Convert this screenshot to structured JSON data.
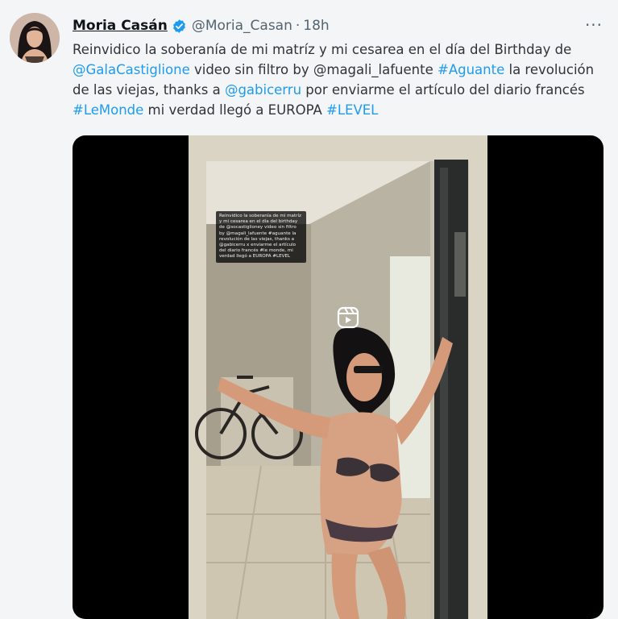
{
  "author": {
    "display_name": "Moria Casán",
    "handle": "@Moria_Casan",
    "separator": "·",
    "time": "18h"
  },
  "more_label": "···",
  "tweet": {
    "t1": "Reinvidico la soberanía de mi matríz y mi cesarea en el día del Birthday de ",
    "m1": "@GalaCastiglione",
    "t2": " video sin filtro by @magali_lafuente ",
    "h1": "#Aguante",
    "t3": " la revolución de las viejas, thanks a ",
    "m2": "@gabicerru",
    "t4": " por enviarme el artículo del diario francés ",
    "h2": "#LeMonde",
    "t5": " mi verdad llegó a EUROPA ",
    "h3": "#LEVEL"
  },
  "video_caption": "Reinvidico la soberanía de mi matríz y mi cesarea en el día del birthday de @socastiglioney video sin filtro by @magali_lafuente #aguante la revolución de las viejas, thanks a @gabicerru x enviarme el artículo del diario francés #le monde, mi verdad llegó a EUROPA #LEVEL",
  "colors": {
    "link": "#1d9bf0",
    "verified": "#1d9bf0",
    "muted": "#536471"
  },
  "icons": [
    "verified-badge-icon",
    "more-options-icon",
    "reels-icon"
  ]
}
